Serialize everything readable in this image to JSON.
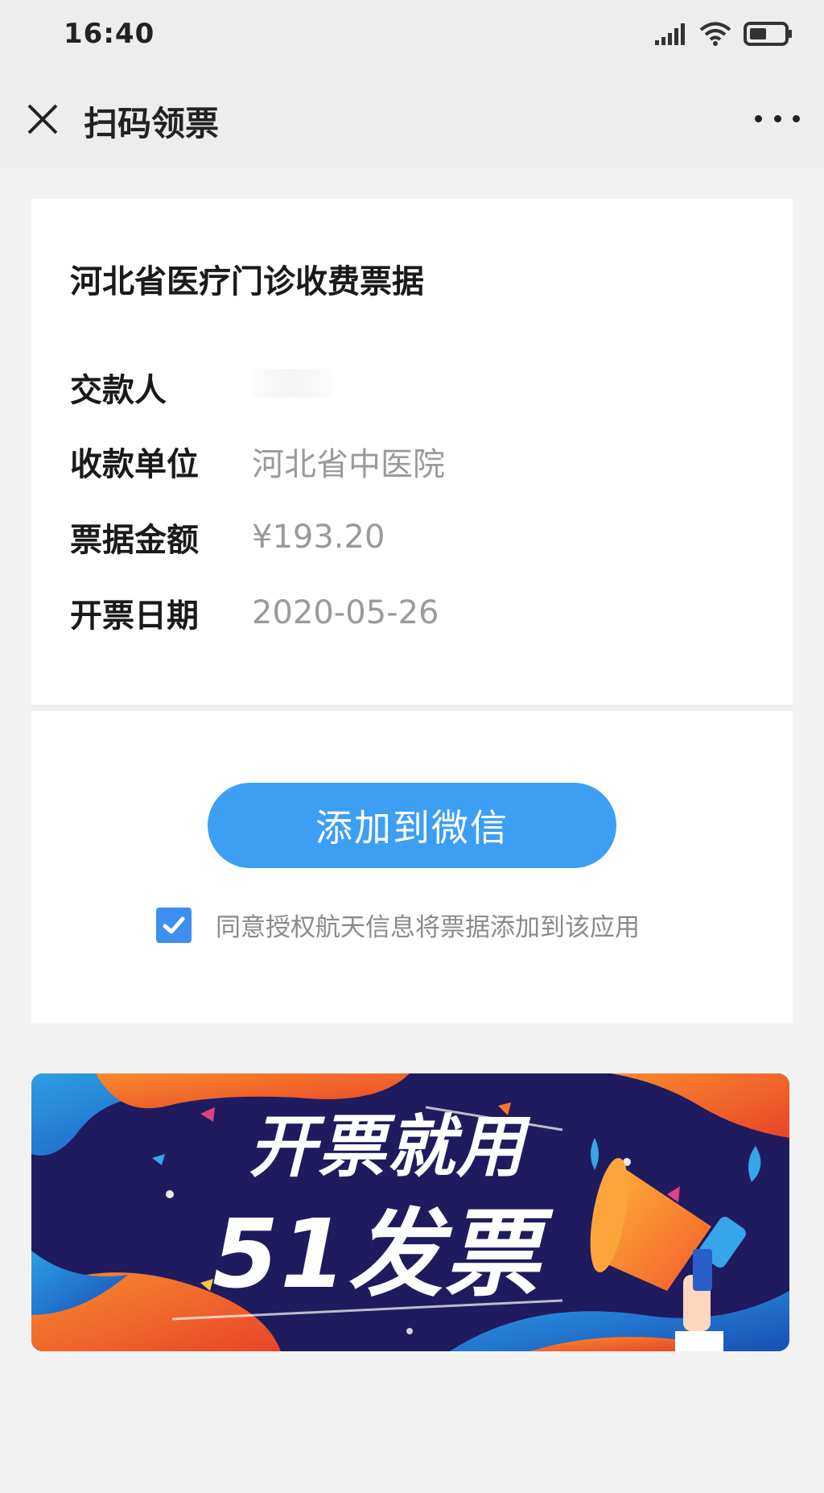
{
  "status_bar": {
    "time": "16:40"
  },
  "navbar": {
    "title": "扫码领票"
  },
  "invoice": {
    "title": "河北省医疗门诊收费票据",
    "rows": [
      {
        "label": "交款人",
        "value": ""
      },
      {
        "label": "收款单位",
        "value": "河北省中医院"
      },
      {
        "label": "票据金额",
        "value": "¥193.20"
      },
      {
        "label": "开票日期",
        "value": "2020-05-26"
      }
    ]
  },
  "actions": {
    "add_button_label": "添加到微信",
    "agree_checked": true,
    "agree_text": "同意授权航天信息将票据添加到该应用"
  },
  "banner": {
    "line1": "开票就用",
    "line2": "51发票"
  },
  "colors": {
    "accent": "#3d9ff4",
    "banner_bg": "#1f1b5e",
    "banner_orange": "#f4772a",
    "banner_blue": "#36a6e8"
  }
}
